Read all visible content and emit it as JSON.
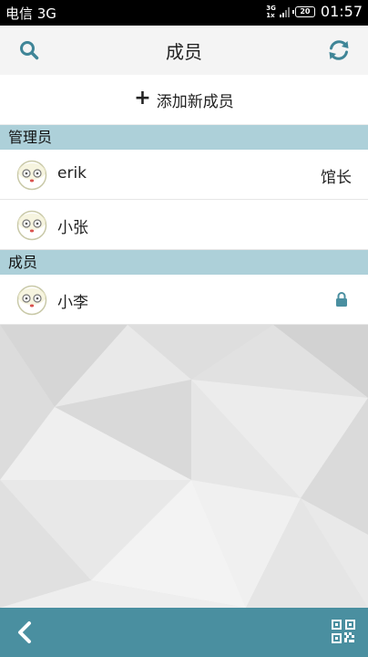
{
  "status_bar": {
    "carrier": "电信 3G",
    "net_top": "3G",
    "net_bottom": "1x",
    "battery": "20",
    "time": "01:57"
  },
  "header": {
    "title": "成员",
    "search_icon": "search-icon",
    "refresh_icon": "refresh-icon"
  },
  "add_member": {
    "label": "添加新成员"
  },
  "sections": {
    "admins": {
      "title": "管理员",
      "items": [
        {
          "name": "erik",
          "role": "馆长"
        },
        {
          "name": "小张",
          "role": ""
        }
      ]
    },
    "members": {
      "title": "成员",
      "items": [
        {
          "name": "小李",
          "locked": true
        }
      ]
    }
  },
  "bottom_bar": {
    "back_icon": "chevron-left-icon",
    "qr_icon": "qr-code-icon"
  },
  "colors": {
    "accent": "#4a8fa0",
    "section_bg": "#add0d9",
    "icon": "#3f8597"
  }
}
